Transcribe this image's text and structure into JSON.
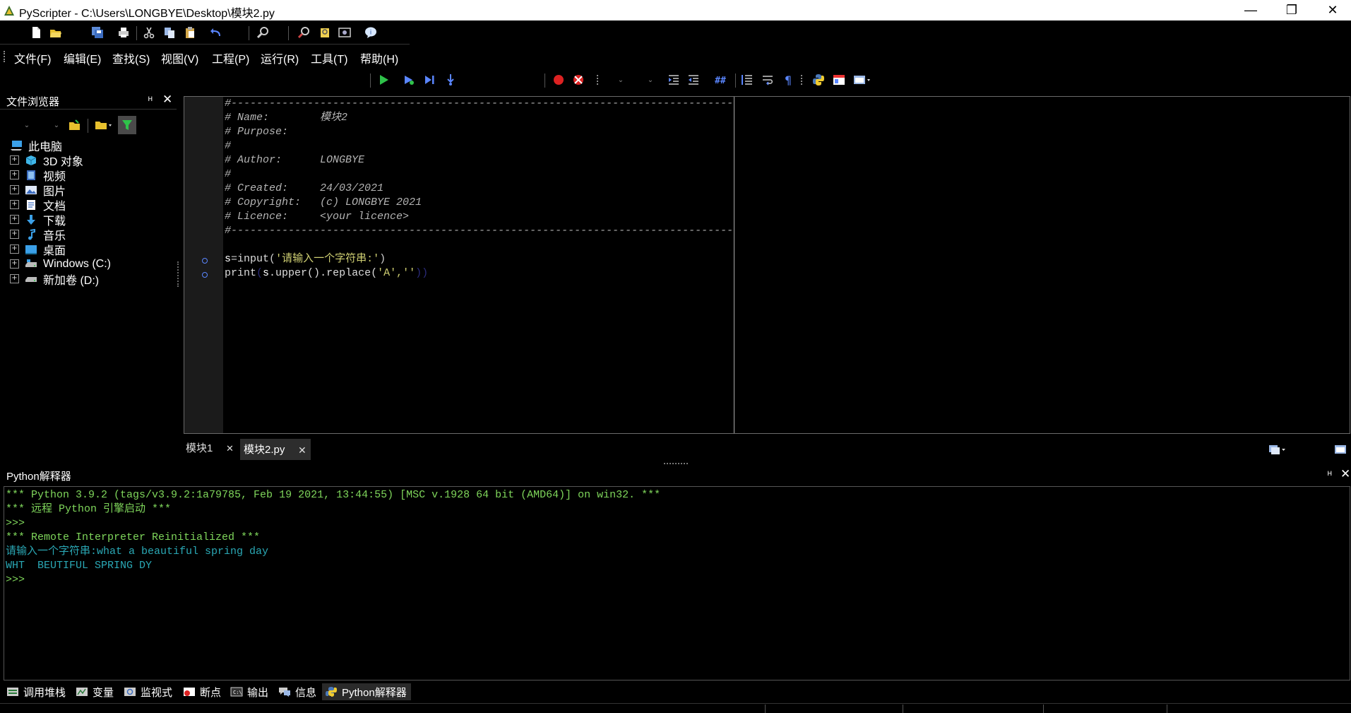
{
  "window": {
    "title": "PyScripter - C:\\Users\\LONGBYE\\Desktop\\模块2.py",
    "minimize": "—",
    "maximize": "❐",
    "close": "✕"
  },
  "menu": {
    "file": "文件(F)",
    "edit": "编辑(E)",
    "search": "查找(S)",
    "view": "视图(V)",
    "project": "工程(P)",
    "run": "运行(R)",
    "tools": "工具(T)",
    "help": "帮助(H)"
  },
  "explorer": {
    "title": "文件浏览器",
    "pin": "ᴴ",
    "close": "✕",
    "root": "此电脑",
    "items": [
      {
        "label": "3D 对象",
        "icon": "cube-icon"
      },
      {
        "label": "视频",
        "icon": "video-icon"
      },
      {
        "label": "图片",
        "icon": "picture-icon"
      },
      {
        "label": "文档",
        "icon": "document-icon"
      },
      {
        "label": "下载",
        "icon": "download-icon"
      },
      {
        "label": "音乐",
        "icon": "music-icon"
      },
      {
        "label": "桌面",
        "icon": "desktop-icon"
      },
      {
        "label": "Windows (C:)",
        "icon": "drive-icon"
      },
      {
        "label": "新加卷 (D:)",
        "icon": "drive-icon"
      }
    ],
    "expand_glyph": "+"
  },
  "editor": {
    "header": {
      "rule": "#-------------------------------------------------------------------------------",
      "name": "# Name:        模块2",
      "purpose": "# Purpose:",
      "blank1": "#",
      "author": "# Author:      LONGBYE",
      "blank2": "#",
      "created": "# Created:     24/03/2021",
      "copyright": "# Copyright:   (c) LONGBYE 2021",
      "licence": "# Licence:     <your licence>",
      "rule_end": "#-------------------------------------------------------------------------------"
    },
    "line1": {
      "var": "s",
      "eq": "=",
      "func": "input",
      "open": "(",
      "str": "'请输入一个字符串:'",
      "close": ")"
    },
    "line2": {
      "func": "print",
      "open": "(",
      "obj": "s",
      "m1": ".upper()",
      "m2": ".replace(",
      "args": "'A',''",
      "close": "))"
    }
  },
  "tabs": {
    "tab1": "模块1",
    "tab1_close": "✕",
    "tab2": "模块2.py",
    "tab2_close": "✕"
  },
  "interpreter": {
    "title": "Python解释器",
    "pin": "ᴴ",
    "close": "✕",
    "lines": [
      "*** Python 3.9.2 (tags/v3.9.2:1a79785, Feb 19 2021, 13:44:55) [MSC v.1928 64 bit (AMD64)] on win32. ***",
      "*** 远程 Python 引擎启动 ***",
      ">>>",
      "*** Remote Interpreter Reinitialized ***",
      "请输入一个字符串:what a beautiful spring day",
      "WHT  BEUTIFUL SPRING DY",
      ">>>"
    ]
  },
  "bottom_tabs": {
    "call_stack": "调用堆栈",
    "variables": "变量",
    "watches": "监视式",
    "breakpoints": "断点",
    "output": "输出",
    "messages": "信息",
    "interpreter": "Python解释器"
  },
  "colors": {
    "comment": "#b4b4b4",
    "interpreter_green": "#7fd65b",
    "interpreter_cyan": "#2aa8b5",
    "string": "#cfcf72"
  }
}
